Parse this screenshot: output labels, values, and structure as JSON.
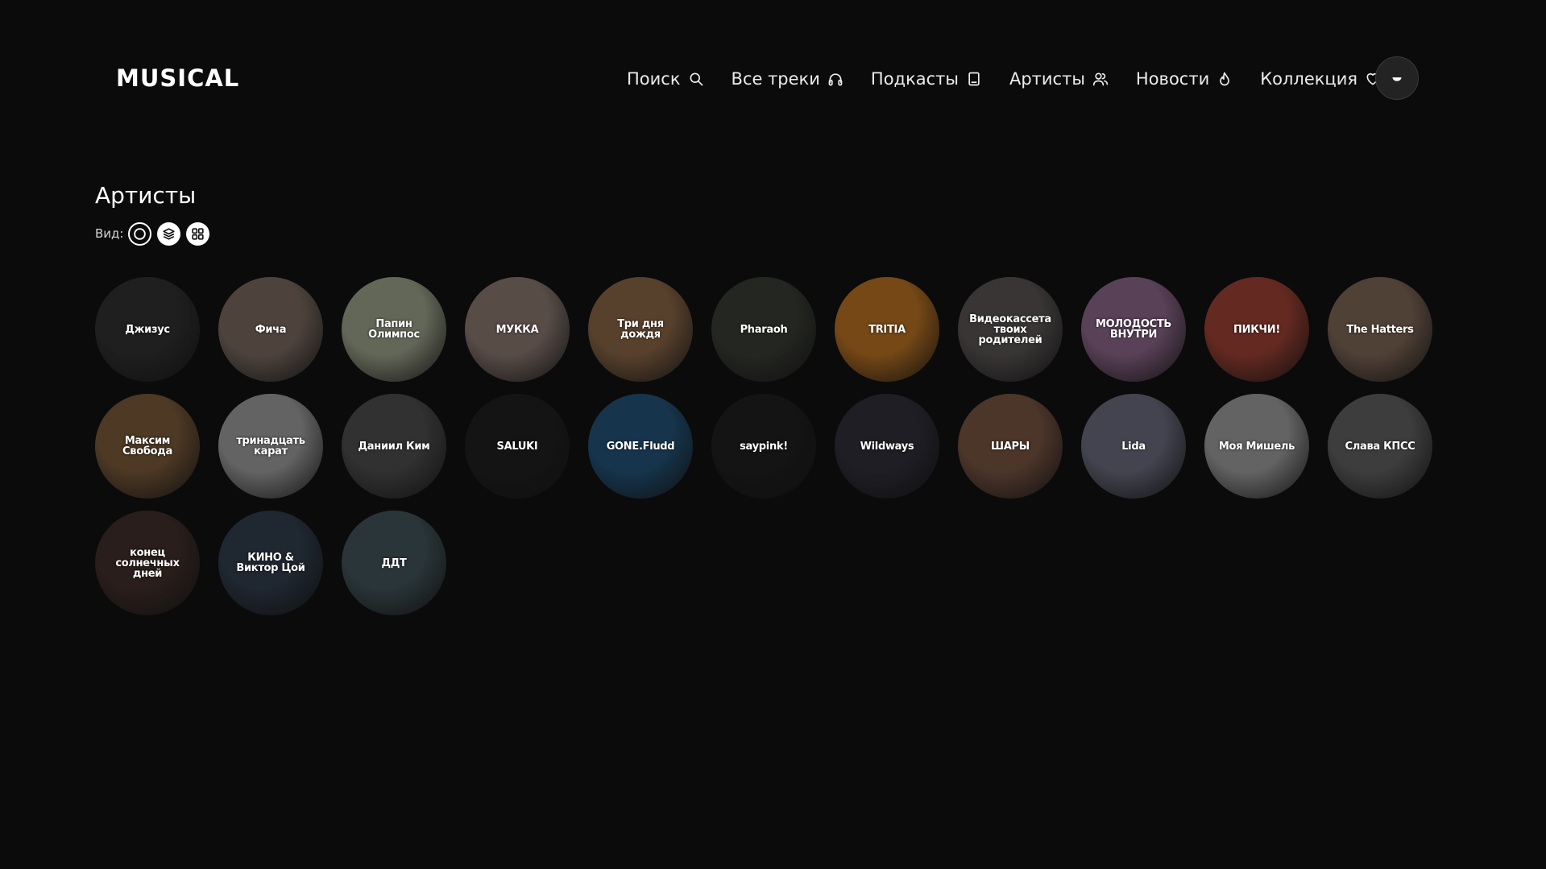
{
  "header": {
    "logo_text": "MUSICAL",
    "nav": [
      {
        "label": "Поиск",
        "icon": "search-icon"
      },
      {
        "label": "Все треки",
        "icon": "headphones-icon"
      },
      {
        "label": "Подкасты",
        "icon": "book-icon"
      },
      {
        "label": "Артисты",
        "icon": "users-icon"
      },
      {
        "label": "Новости",
        "icon": "flame-icon"
      },
      {
        "label": "Коллекция",
        "icon": "heart-icon"
      }
    ],
    "avatar_icon": "avatar-icon"
  },
  "main": {
    "title": "Артисты",
    "view_label": "Вид:",
    "view_options": [
      {
        "name": "circle-view",
        "icon": "circle-icon",
        "style": "outline"
      },
      {
        "name": "stack-view",
        "icon": "layers-icon",
        "style": "filled"
      },
      {
        "name": "grid-view",
        "icon": "grid-icon",
        "style": "filled"
      }
    ]
  },
  "artists": [
    {
      "name": "Джизус",
      "bg": "#2b2b2b"
    },
    {
      "name": "Фича",
      "bg": "#6b5e54"
    },
    {
      "name": "Папин Олимпос",
      "bg": "#8a8f7a"
    },
    {
      "name": "МУККА",
      "bg": "#7a6a63"
    },
    {
      "name": "Три дня дождя",
      "bg": "#7a5a3e"
    },
    {
      "name": "Pharaoh",
      "bg": "#33362f"
    },
    {
      "name": "TRITIA",
      "bg": "#a3641f"
    },
    {
      "name": "Видеокассета твоих родителей",
      "bg": "#4f4a4a"
    },
    {
      "name": "МОЛОДОСТЬ ВНУТРИ",
      "bg": "#7c5a7a"
    },
    {
      "name": "ПИКЧИ!",
      "bg": "#8b3a2e"
    },
    {
      "name": "The Hatters",
      "bg": "#6f5a4c"
    },
    {
      "name": "Максим Свобода",
      "bg": "#6b4f33"
    },
    {
      "name": "тринадцать карат",
      "bg": "#8a8a8a"
    },
    {
      "name": "Даниил Ким",
      "bg": "#444444"
    },
    {
      "name": "SALUKI",
      "bg": "#1d1d1d"
    },
    {
      "name": "GONE.Fludd",
      "bg": "#1f4a6b"
    },
    {
      "name": "saypink!",
      "bg": "#1c1c1c"
    },
    {
      "name": "Wildways",
      "bg": "#2a2a33"
    },
    {
      "name": "ШАРЫ",
      "bg": "#6a4a3a"
    },
    {
      "name": "Lida",
      "bg": "#5d5f6e"
    },
    {
      "name": "Моя Мишель",
      "bg": "#8a8a8a"
    },
    {
      "name": "Слава КПСС",
      "bg": "#555555"
    },
    {
      "name": "конец солнечных дней",
      "bg": "#3a2a26"
    },
    {
      "name": "КИНО & Виктор Цой",
      "bg": "#2b3644"
    },
    {
      "name": "ДДТ",
      "bg": "#3a4a4f"
    }
  ]
}
